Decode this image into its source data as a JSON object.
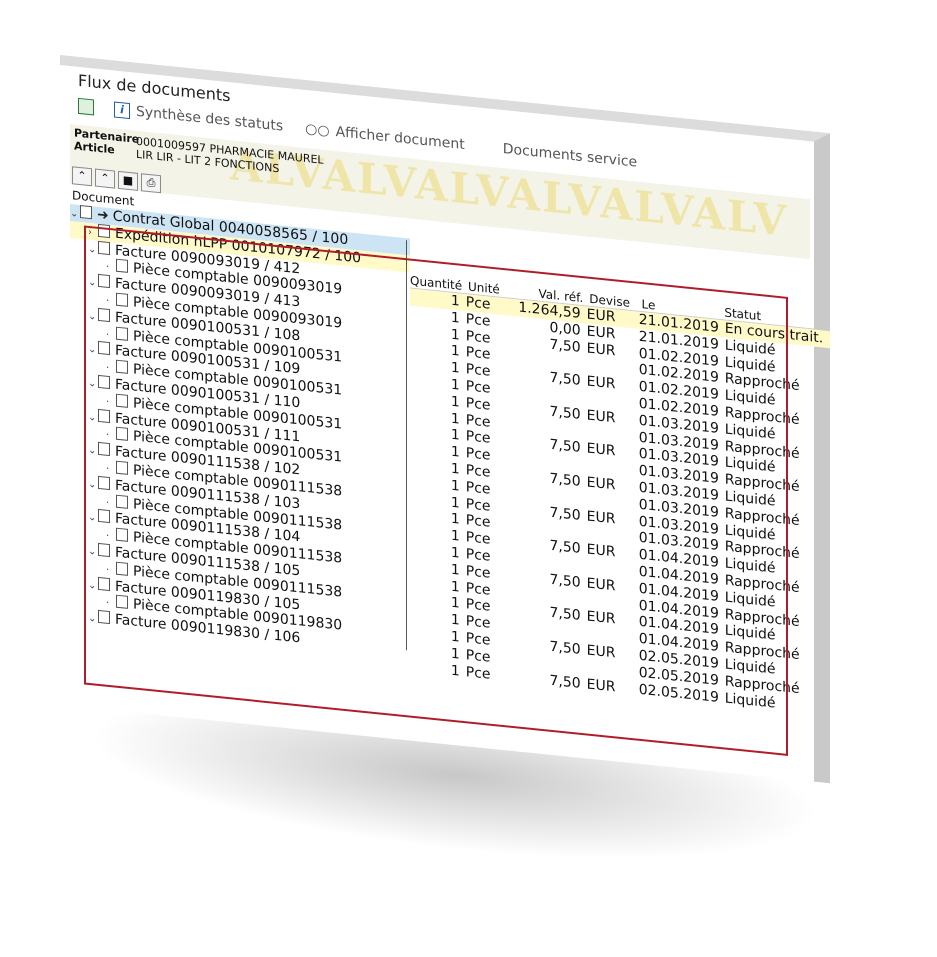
{
  "window": {
    "title": "Flux de documents"
  },
  "toolbar": {
    "btn1": "Synthèse des statuts",
    "btn2": "Afficher document",
    "btn3": "Documents service"
  },
  "header": {
    "partenaire_label": "Partenaire",
    "partenaire_value": "0001009597 PHARMACIE MAUREL",
    "article_label": "Article",
    "article_value": "LIR LIR - LIT 2 FONCTIONS",
    "watermark": "ALVALVALVALVALVALV"
  },
  "columns": {
    "document": "Document",
    "quantite": "Quantité",
    "unite": "Unité",
    "valref": "Val. réf.",
    "devise": "Devise",
    "le": "Le",
    "statut": "Statut"
  },
  "tree": [
    {
      "label": "Contrat Global 0040058565 / 100",
      "level": 0
    },
    {
      "label": "Expédition hLPP 0010107972 / 100",
      "level": 1
    },
    {
      "label": "Facture 0090093019 / 412",
      "level": 1
    },
    {
      "label": "Pièce comptable 0090093019",
      "level": 2
    },
    {
      "label": "Facture 0090093019 / 413",
      "level": 1
    },
    {
      "label": "Pièce comptable 0090093019",
      "level": 2
    },
    {
      "label": "Facture 0090100531 / 108",
      "level": 1
    },
    {
      "label": "Pièce comptable 0090100531",
      "level": 2
    },
    {
      "label": "Facture 0090100531 / 109",
      "level": 1
    },
    {
      "label": "Pièce comptable 0090100531",
      "level": 2
    },
    {
      "label": "Facture 0090100531 / 110",
      "level": 1
    },
    {
      "label": "Pièce comptable 0090100531",
      "level": 2
    },
    {
      "label": "Facture 0090100531 / 111",
      "level": 1
    },
    {
      "label": "Pièce comptable 0090100531",
      "level": 2
    },
    {
      "label": "Facture 0090111538 / 102",
      "level": 1
    },
    {
      "label": "Pièce comptable 0090111538",
      "level": 2
    },
    {
      "label": "Facture 0090111538 / 103",
      "level": 1
    },
    {
      "label": "Pièce comptable 0090111538",
      "level": 2
    },
    {
      "label": "Facture 0090111538 / 104",
      "level": 1
    },
    {
      "label": "Pièce comptable 0090111538",
      "level": 2
    },
    {
      "label": "Facture 0090111538 / 105",
      "level": 1
    },
    {
      "label": "Pièce comptable 0090111538",
      "level": 2
    },
    {
      "label": "Facture 0090119830 / 105",
      "level": 1
    },
    {
      "label": "Pièce comptable 0090119830",
      "level": 2
    },
    {
      "label": "Facture 0090119830 / 106",
      "level": 1
    }
  ],
  "rows": [
    {
      "q": "1",
      "u": "Pce",
      "v": "1.264,59",
      "d": "EUR",
      "le": "21.01.2019",
      "s": "En cours trait."
    },
    {
      "q": "1",
      "u": "Pce",
      "v": "0,00",
      "d": "EUR",
      "le": "21.01.2019",
      "s": "Liquidé"
    },
    {
      "q": "1",
      "u": "Pce",
      "v": "7,50",
      "d": "EUR",
      "le": "01.02.2019",
      "s": "Liquidé"
    },
    {
      "q": "1",
      "u": "Pce",
      "v": "",
      "d": "",
      "le": "01.02.2019",
      "s": "Rapproché"
    },
    {
      "q": "1",
      "u": "Pce",
      "v": "7,50",
      "d": "EUR",
      "le": "01.02.2019",
      "s": "Liquidé"
    },
    {
      "q": "1",
      "u": "Pce",
      "v": "",
      "d": "",
      "le": "01.02.2019",
      "s": "Rapproché"
    },
    {
      "q": "1",
      "u": "Pce",
      "v": "7,50",
      "d": "EUR",
      "le": "01.03.2019",
      "s": "Liquidé"
    },
    {
      "q": "1",
      "u": "Pce",
      "v": "",
      "d": "",
      "le": "01.03.2019",
      "s": "Rapproché"
    },
    {
      "q": "1",
      "u": "Pce",
      "v": "7,50",
      "d": "EUR",
      "le": "01.03.2019",
      "s": "Liquidé"
    },
    {
      "q": "1",
      "u": "Pce",
      "v": "",
      "d": "",
      "le": "01.03.2019",
      "s": "Rapproché"
    },
    {
      "q": "1",
      "u": "Pce",
      "v": "7,50",
      "d": "EUR",
      "le": "01.03.2019",
      "s": "Liquidé"
    },
    {
      "q": "1",
      "u": "Pce",
      "v": "",
      "d": "",
      "le": "01.03.2019",
      "s": "Rapproché"
    },
    {
      "q": "1",
      "u": "Pce",
      "v": "7,50",
      "d": "EUR",
      "le": "01.03.2019",
      "s": "Liquidé"
    },
    {
      "q": "1",
      "u": "Pce",
      "v": "",
      "d": "",
      "le": "01.03.2019",
      "s": "Rapproché"
    },
    {
      "q": "1",
      "u": "Pce",
      "v": "7,50",
      "d": "EUR",
      "le": "01.04.2019",
      "s": "Liquidé"
    },
    {
      "q": "1",
      "u": "Pce",
      "v": "",
      "d": "",
      "le": "01.04.2019",
      "s": "Rapproché"
    },
    {
      "q": "1",
      "u": "Pce",
      "v": "7,50",
      "d": "EUR",
      "le": "01.04.2019",
      "s": "Liquidé"
    },
    {
      "q": "1",
      "u": "Pce",
      "v": "",
      "d": "",
      "le": "01.04.2019",
      "s": "Rapproché"
    },
    {
      "q": "1",
      "u": "Pce",
      "v": "7,50",
      "d": "EUR",
      "le": "01.04.2019",
      "s": "Liquidé"
    },
    {
      "q": "1",
      "u": "Pce",
      "v": "",
      "d": "",
      "le": "01.04.2019",
      "s": "Rapproché"
    },
    {
      "q": "1",
      "u": "Pce",
      "v": "7,50",
      "d": "EUR",
      "le": "02.05.2019",
      "s": "Liquidé"
    },
    {
      "q": "1",
      "u": "Pce",
      "v": "",
      "d": "",
      "le": "02.05.2019",
      "s": "Rapproché"
    },
    {
      "q": "1",
      "u": "Pce",
      "v": "7,50",
      "d": "EUR",
      "le": "02.05.2019",
      "s": "Liquidé"
    }
  ],
  "colors": {
    "highlight_yellow": "#fffac8",
    "highlight_blue": "#cde4f5",
    "red_box": "#b01d2a"
  }
}
